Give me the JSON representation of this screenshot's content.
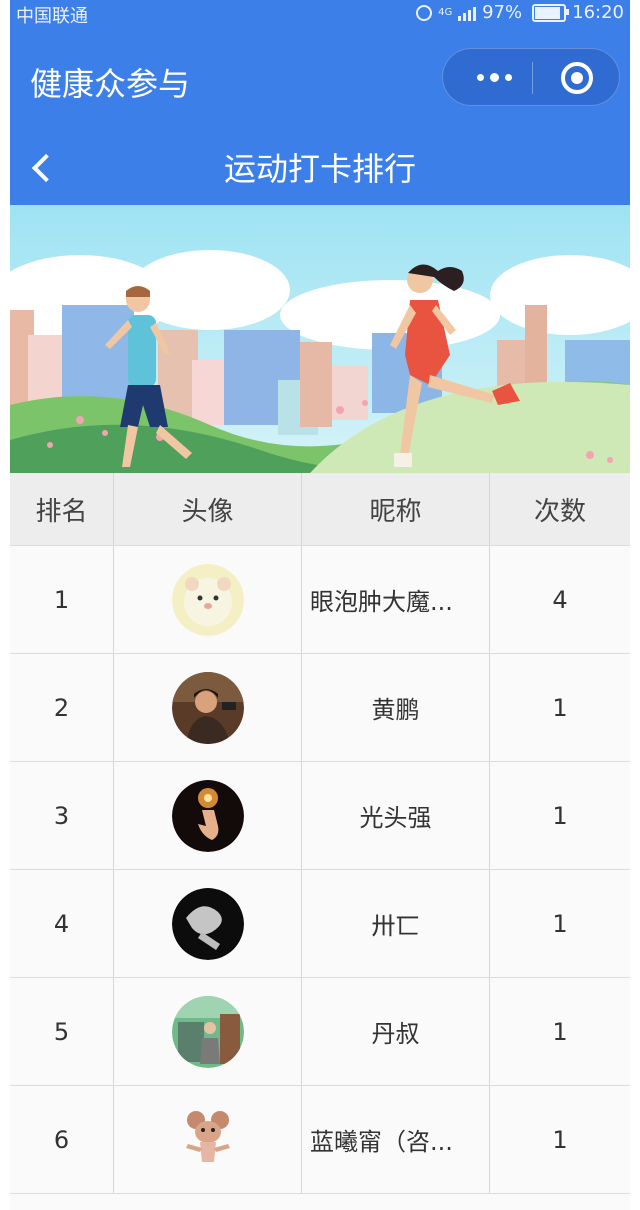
{
  "status_bar": {
    "carrier": "中国联通",
    "network": "4G",
    "battery_percent": "97%",
    "battery_level": 0.97,
    "time": "16:20",
    "icons": [
      "alarm-icon",
      "signal-icon",
      "battery-icon"
    ]
  },
  "app": {
    "title": "健康众参与",
    "capsule_icons": [
      "more-icon",
      "close-miniprogram-icon"
    ]
  },
  "nav": {
    "title": "运动打卡排行",
    "back_icon": "chevron-left-icon"
  },
  "banner": {
    "description_icon": "running-banner-illustration"
  },
  "table": {
    "headers": [
      "排名",
      "头像",
      "昵称",
      "次数"
    ],
    "rows": [
      {
        "rank": "1",
        "nickname": "眼泡肿大魔...",
        "count": "4",
        "avatar": "hamster-avatar"
      },
      {
        "rank": "2",
        "nickname": "黄鹏",
        "count": "1",
        "avatar": "man-photo-avatar"
      },
      {
        "rank": "3",
        "nickname": "光头强",
        "count": "1",
        "avatar": "hand-light-avatar"
      },
      {
        "rank": "4",
        "nickname": "卅匸",
        "count": "1",
        "avatar": "dark-smoke-avatar"
      },
      {
        "rank": "5",
        "nickname": "丹叔",
        "count": "1",
        "avatar": "train-station-avatar"
      },
      {
        "rank": "6",
        "nickname": "蓝曦甯（咨...",
        "count": "1",
        "avatar": "cartoon-mouse-avatar"
      }
    ]
  },
  "colors": {
    "header_blue": "#3c7fe8",
    "table_header_bg": "#ededed",
    "row_bg": "#fafafa"
  }
}
